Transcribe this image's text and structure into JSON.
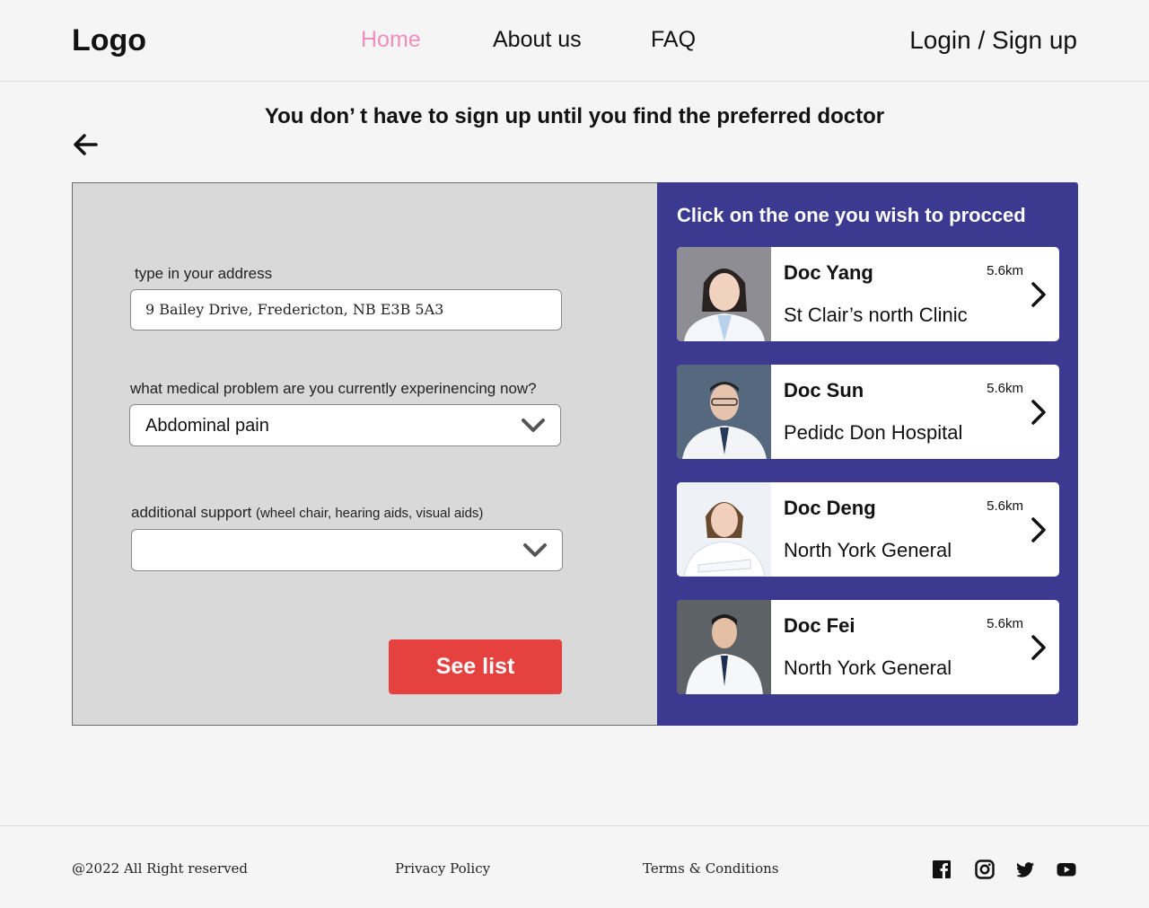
{
  "header": {
    "logo": "Logo",
    "nav": {
      "home": "Home",
      "about": "About us",
      "faq": "FAQ"
    },
    "login": "Login / Sign up",
    "accent_color": "#ee8fbd"
  },
  "headline": "You don’ t have to sign up until you find the preferred doctor",
  "form": {
    "address_label": "type in your address",
    "address_value": "9 Bailey Drive, Fredericton, NB E3B 5A3",
    "problem_label": "what medical problem are you currently experinencing now?",
    "problem_value": "Abdominal pain",
    "support_label": "additional support",
    "support_hint": "(wheel chair, hearing aids, visual aids)",
    "support_value": "",
    "see_list": "See list",
    "button_color": "#e5413f"
  },
  "doctor_list": {
    "title": "Click on the one you wish to procced",
    "panel_color": "#3c3990",
    "doctors": [
      {
        "name": "Doc Yang",
        "distance": "5.6km",
        "clinic": " St Clair’s north Clinic"
      },
      {
        "name": "Doc Sun",
        "distance": "5.6km",
        "clinic": "Pedidc  Don Hospital"
      },
      {
        "name": "Doc Deng",
        "distance": "5.6km",
        "clinic": "North York General"
      },
      {
        "name": "Doc Fei",
        "distance": "5.6km",
        "clinic": "North York General"
      }
    ]
  },
  "footer": {
    "copyright": "@2022 All Right reserved",
    "privacy": "Privacy Policy",
    "terms": "Terms & Conditions",
    "social_icons": [
      "facebook-icon",
      "instagram-icon",
      "twitter-icon",
      "youtube-icon"
    ]
  }
}
